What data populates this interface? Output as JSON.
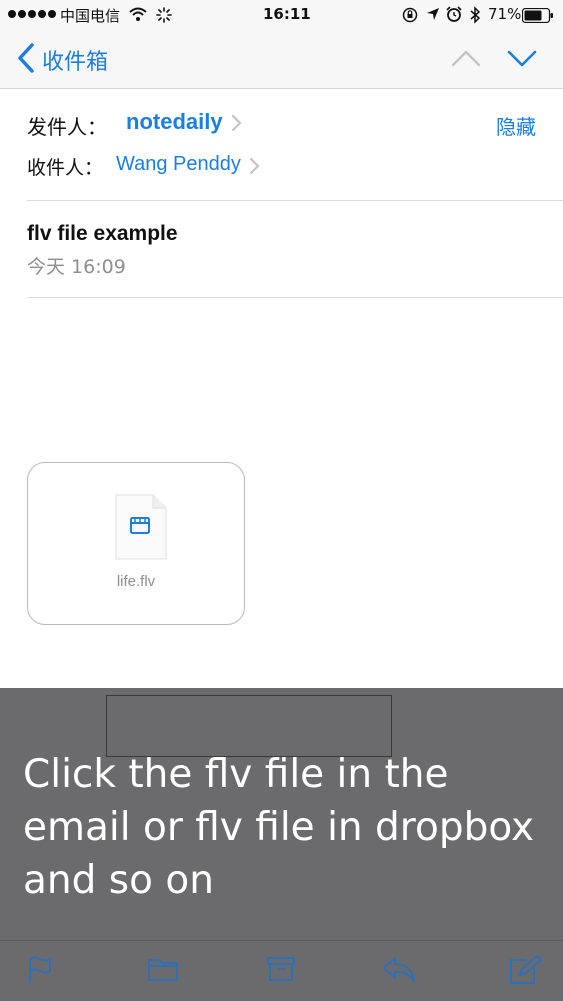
{
  "status_bar": {
    "carrier": "中国电信",
    "time": "16:11",
    "battery_percent": "71%",
    "icons": [
      "signal-icon",
      "wifi-icon",
      "loading-icon",
      "lock-rotation-icon",
      "location-icon",
      "alarm-icon",
      "bluetooth-icon",
      "battery-icon"
    ]
  },
  "nav": {
    "back_label": "收件箱",
    "icons": [
      "chevron-left-icon",
      "chevron-up-icon",
      "chevron-down-icon"
    ]
  },
  "email": {
    "from_label": "发件人：",
    "from_name": "notedaily",
    "to_label": "收件人：",
    "to_name": "Wang Penddy",
    "hide_label": "隐藏",
    "subject": "flv file example",
    "date": "今天 16:09"
  },
  "attachment": {
    "filename": "life.flv",
    "icon": "video-file-icon"
  },
  "overlay": {
    "text": "Click the flv file in the email or flv file in dropbox and so on"
  },
  "toolbar": {
    "icons": [
      "flag-icon",
      "folder-icon",
      "archive-icon",
      "reply-icon",
      "compose-icon"
    ]
  },
  "colors": {
    "accent": "#1a7fe0",
    "overlay": "#6b6b6d",
    "secondary_text": "#8e8e93"
  }
}
